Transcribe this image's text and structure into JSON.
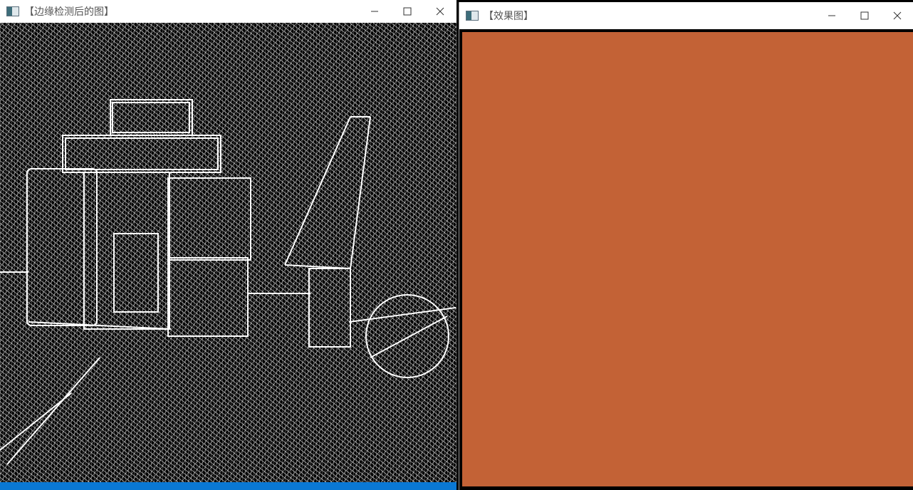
{
  "edge_window": {
    "title": "【边缘检测后的图】"
  },
  "result_window": {
    "title": "【效果图】",
    "fill_color": "#c36236"
  },
  "colors": {
    "titlebar_bg": "#ffffff",
    "taskbar_accent": "#0a78d4",
    "edge_background": "#000000",
    "edge_lines": "#ffffff"
  },
  "icons": {
    "app": "app-window-icon",
    "minimize": "minimize-icon",
    "maximize": "maximize-icon",
    "close": "close-icon"
  }
}
